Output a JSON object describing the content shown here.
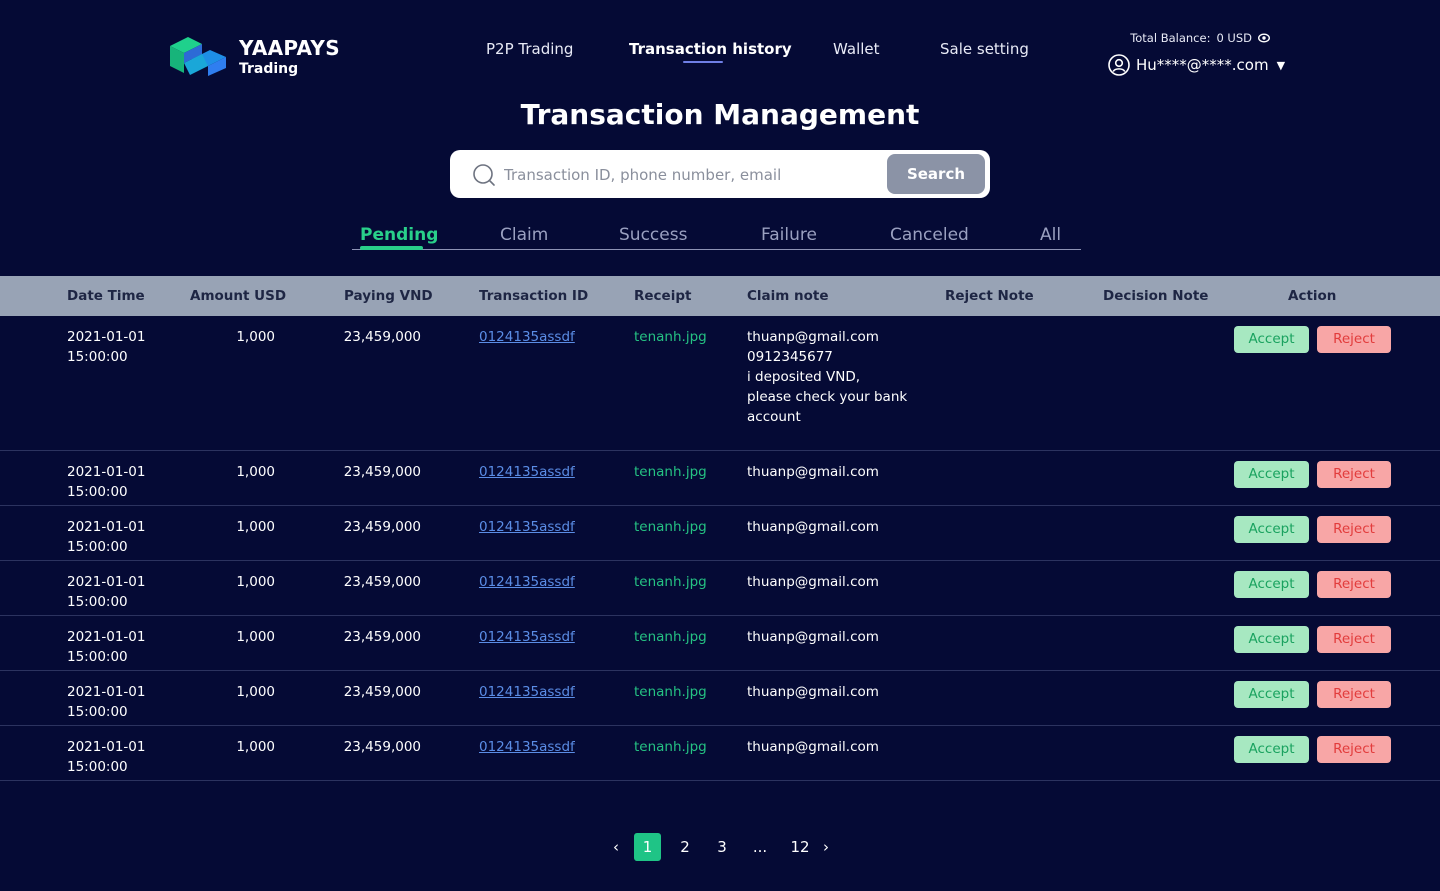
{
  "brand": {
    "name": "YAAPAYS",
    "sub": "Trading"
  },
  "nav": {
    "items": [
      "P2P Trading",
      "Transaction history",
      "Wallet",
      "Sale setting"
    ],
    "active": "Transaction history"
  },
  "account": {
    "balance_label": "Total Balance:",
    "balance_value": "0 USD",
    "email": "Hu****@****.com"
  },
  "page": {
    "title": "Transaction Management"
  },
  "search": {
    "placeholder": "Transaction ID, phone number, email",
    "button": "Search"
  },
  "tabs": {
    "items": [
      "Pending",
      "Claim",
      "Success",
      "Failure",
      "Canceled",
      "All"
    ],
    "active": "Pending"
  },
  "table": {
    "headers": [
      "Date Time",
      "Amount USD",
      "Paying VND",
      "Transaction ID",
      "Receipt",
      "Claim note",
      "Reject Note",
      "Decision Note",
      "Action"
    ],
    "accept_label": "Accept",
    "reject_label": "Reject",
    "rows": [
      {
        "date": "2021-01-01",
        "time": "15:00:00",
        "amount": "1,000",
        "paying": "23,459,000",
        "tx_id": "0124135assdf",
        "receipt": "tenanh.jpg",
        "claim_note": "thuanp@gmail.com\n0912345677\n i deposited VND,\nplease check your bank\naccount",
        "reject_note": "",
        "decision_note": ""
      },
      {
        "date": "2021-01-01",
        "time": "15:00:00",
        "amount": "1,000",
        "paying": "23,459,000",
        "tx_id": "0124135assdf",
        "receipt": "tenanh.jpg",
        "claim_note": "thuanp@gmail.com",
        "reject_note": "",
        "decision_note": ""
      },
      {
        "date": "2021-01-01",
        "time": "15:00:00",
        "amount": "1,000",
        "paying": "23,459,000",
        "tx_id": "0124135assdf",
        "receipt": "tenanh.jpg",
        "claim_note": "thuanp@gmail.com",
        "reject_note": "",
        "decision_note": ""
      },
      {
        "date": "2021-01-01",
        "time": "15:00:00",
        "amount": "1,000",
        "paying": "23,459,000",
        "tx_id": "0124135assdf",
        "receipt": "tenanh.jpg",
        "claim_note": "thuanp@gmail.com",
        "reject_note": "",
        "decision_note": ""
      },
      {
        "date": "2021-01-01",
        "time": "15:00:00",
        "amount": "1,000",
        "paying": "23,459,000",
        "tx_id": "0124135assdf",
        "receipt": "tenanh.jpg",
        "claim_note": "thuanp@gmail.com",
        "reject_note": "",
        "decision_note": ""
      },
      {
        "date": "2021-01-01",
        "time": "15:00:00",
        "amount": "1,000",
        "paying": "23,459,000",
        "tx_id": "0124135assdf",
        "receipt": "tenanh.jpg",
        "claim_note": "thuanp@gmail.com",
        "reject_note": "",
        "decision_note": ""
      },
      {
        "date": "2021-01-01",
        "time": "15:00:00",
        "amount": "1,000",
        "paying": "23,459,000",
        "tx_id": "0124135assdf",
        "receipt": "tenanh.jpg",
        "claim_note": "thuanp@gmail.com",
        "reject_note": "",
        "decision_note": ""
      }
    ]
  },
  "pagination": {
    "prev": "‹",
    "pages": [
      "1",
      "2",
      "3",
      "...",
      "12"
    ],
    "next": "›",
    "current": "1"
  },
  "colors": {
    "background": "#050a35",
    "accent_green": "#29d08a",
    "nav_underline": "#6f7fe6",
    "table_header": "#98a3b5",
    "link": "#5b8de6"
  },
  "icons": {
    "logo": "yaapays-logo",
    "balance_toggle": "eye-icon",
    "user": "user-circle-icon",
    "search": "search-icon"
  }
}
